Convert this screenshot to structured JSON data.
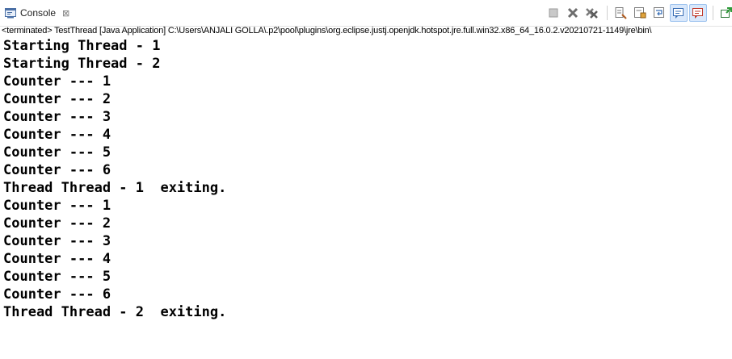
{
  "tab": {
    "label": "Console",
    "close_glyph": "⊠",
    "icon": "console-icon"
  },
  "toolbar": {
    "buttons": [
      {
        "icon": "terminate-icon"
      },
      {
        "icon": "remove-launch-icon"
      },
      {
        "icon": "remove-all-terminated-icon"
      },
      {
        "icon": "clear-console-icon"
      },
      {
        "icon": "scroll-lock-icon"
      },
      {
        "icon": "word-wrap-icon"
      },
      {
        "icon": "show-on-stdout-icon",
        "active": true
      },
      {
        "icon": "show-on-stderr-icon",
        "active": true
      },
      {
        "icon": "pin-console-icon"
      },
      {
        "icon": "display-selected-console-icon"
      }
    ]
  },
  "status": "<terminated> TestThread [Java Application] C:\\Users\\ANJALI GOLLA\\.p2\\pool\\plugins\\org.eclipse.justj.openjdk.hotspot.jre.full.win32.x86_64_16.0.2.v20210721-1149\\jre\\bin\\",
  "console": {
    "lines": [
      "Starting Thread - 1",
      "Starting Thread - 2",
      "Counter --- 1",
      "Counter --- 2",
      "Counter --- 3",
      "Counter --- 4",
      "Counter --- 5",
      "Counter --- 6",
      "Thread Thread - 1  exiting.",
      "Counter --- 1",
      "Counter --- 2",
      "Counter --- 3",
      "Counter --- 4",
      "Counter --- 5",
      "Counter --- 6",
      "Thread Thread - 2  exiting."
    ]
  }
}
